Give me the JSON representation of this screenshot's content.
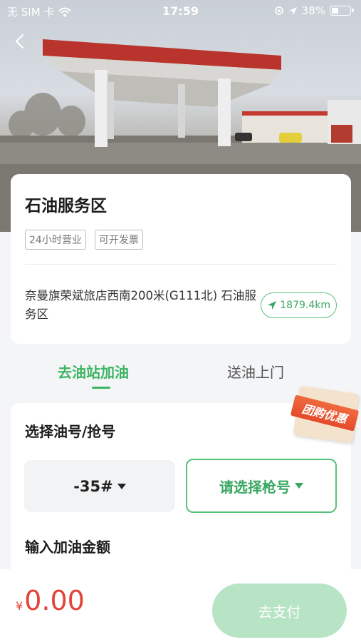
{
  "status_bar": {
    "carrier": "无 SIM 卡",
    "time": "17:59",
    "battery_percent": "38%",
    "battery_level": 0.38
  },
  "station": {
    "name": "石油服务区",
    "tags": [
      "24小时营业",
      "可开发票"
    ],
    "address": "奈曼旗荣斌旅店西南200米(G111北) 石油服务区",
    "distance": "1879.4km"
  },
  "tabs": {
    "active": "去油站加油",
    "inactive": "送油上门"
  },
  "form": {
    "oil_label": "选择油号/抢号",
    "oil_value": "-35#",
    "gun_placeholder": "请选择枪号",
    "amount_label": "输入加油金额",
    "promo_badge": "团购优惠"
  },
  "footer": {
    "currency": "¥",
    "total": "0.00",
    "pay_label": "去支付"
  },
  "colors": {
    "accent": "#3db464",
    "price": "#e34339",
    "pay_disabled": "#b8e4c6"
  }
}
